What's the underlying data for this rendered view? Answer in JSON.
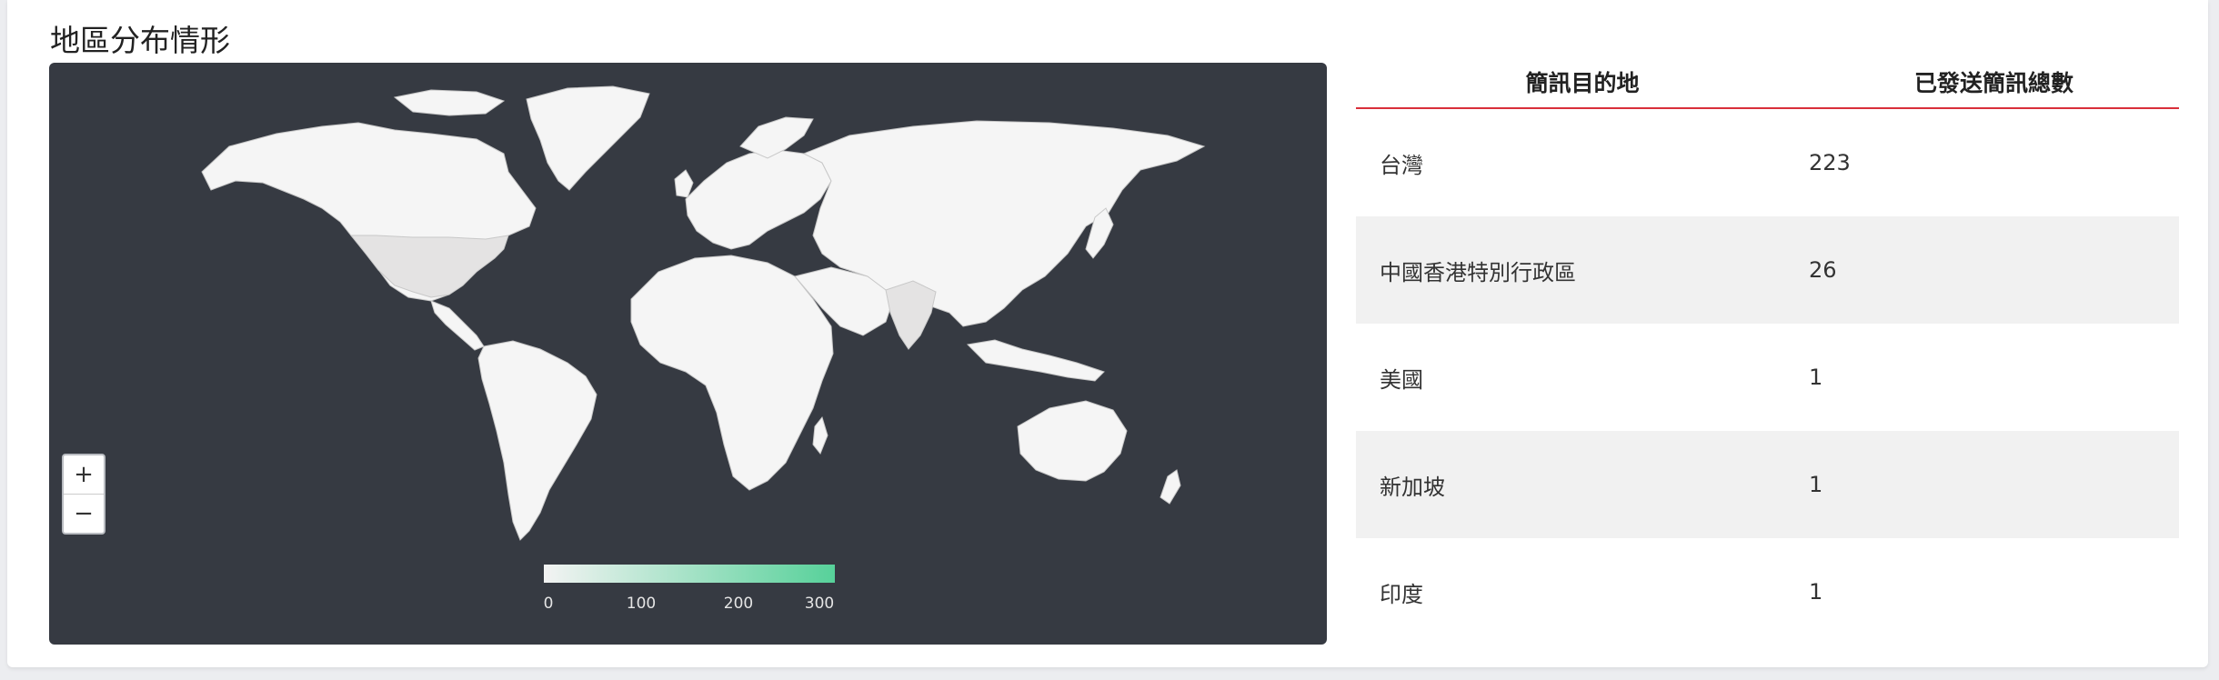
{
  "section": {
    "title": "地區分布情形"
  },
  "map": {
    "background_color": "#363a42",
    "land_color": "#f5f5f5",
    "zoom_in_label": "+",
    "zoom_out_label": "−",
    "legend": {
      "min_color": "#f3f3f3",
      "max_color": "#57d19a",
      "ticks": [
        "0",
        "100",
        "200",
        "300"
      ]
    },
    "highlighted_regions": [
      "United States",
      "India"
    ]
  },
  "table": {
    "columns": [
      "簡訊目的地",
      "已發送簡訊總數"
    ],
    "header_underline_color": "#d92f3a",
    "rows": [
      {
        "destination": "台灣",
        "count": "223"
      },
      {
        "destination": "中國香港特別行政區",
        "count": "26"
      },
      {
        "destination": "美國",
        "count": "1"
      },
      {
        "destination": "新加坡",
        "count": "1"
      },
      {
        "destination": "印度",
        "count": "1"
      }
    ]
  }
}
